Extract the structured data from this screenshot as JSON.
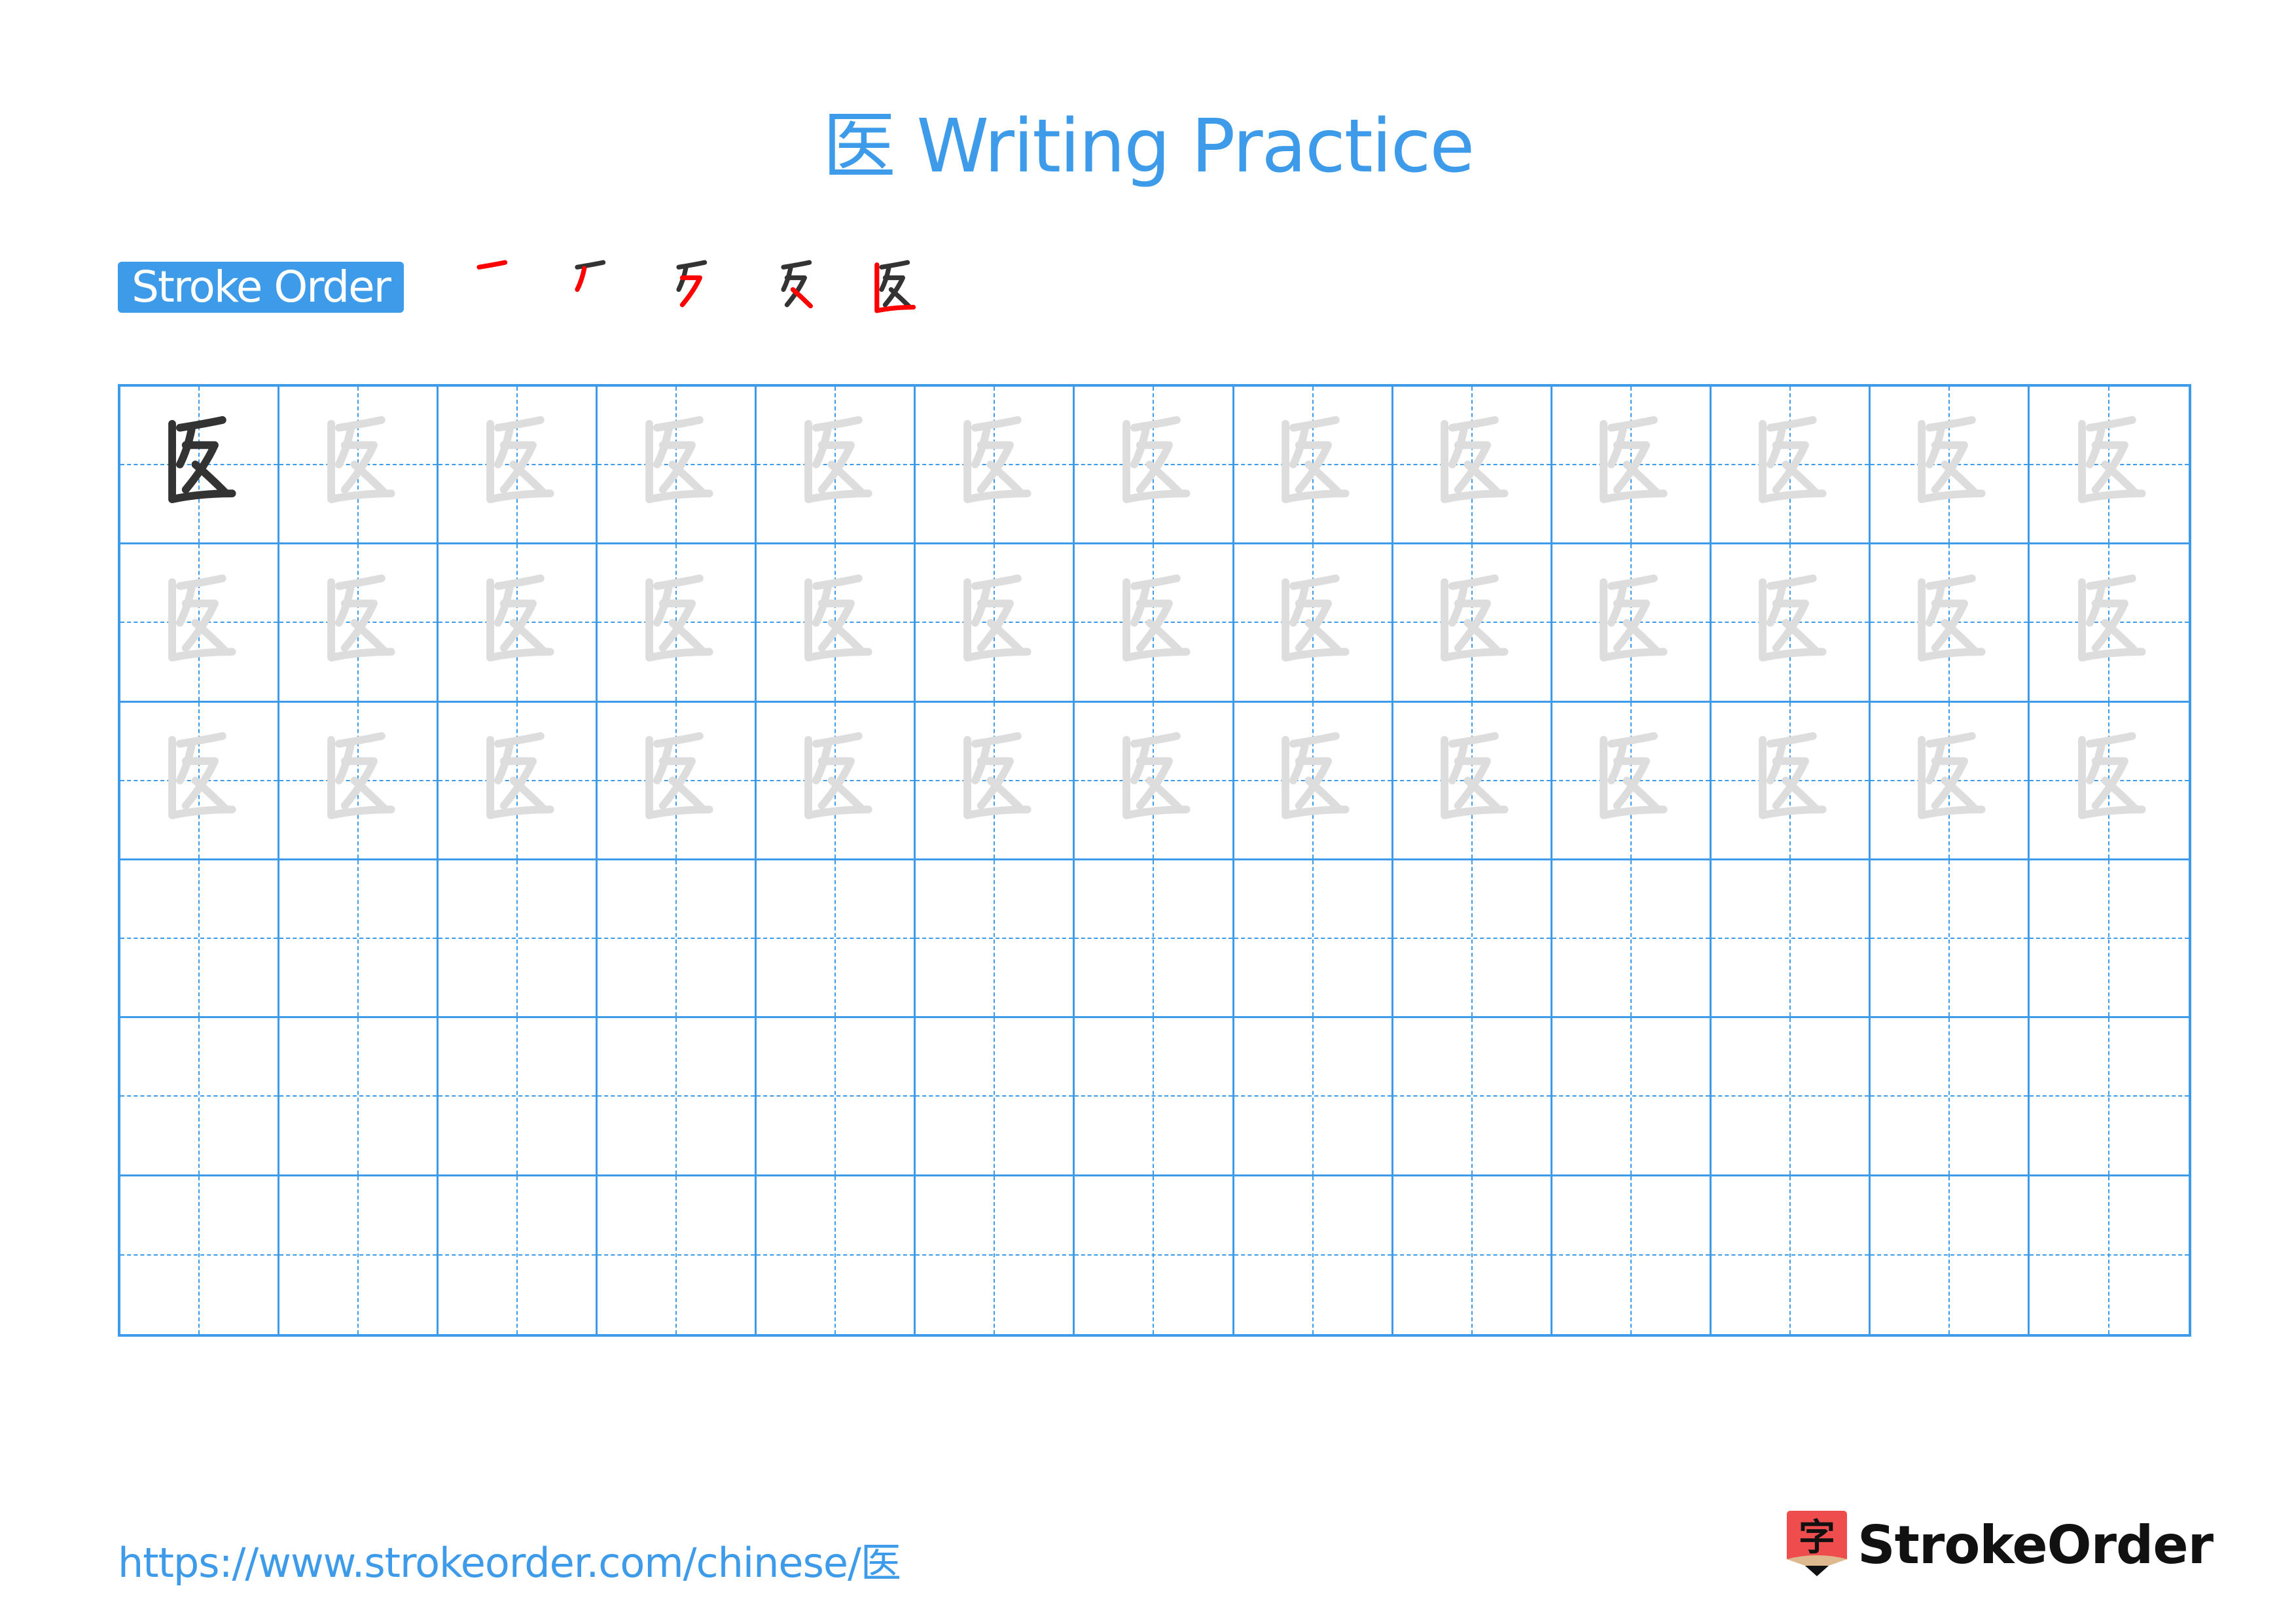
{
  "page": {
    "title": "医 Writing Practice",
    "character": "医"
  },
  "stroke_order": {
    "label": "Stroke Order",
    "total_strokes": 5,
    "steps": [
      {
        "step": 1,
        "highlight_color": "#f00"
      },
      {
        "step": 2,
        "highlight_color": "#f00"
      },
      {
        "step": 3,
        "highlight_color": "#f00"
      },
      {
        "step": 4,
        "highlight_color": "#f00"
      },
      {
        "step": 5,
        "highlight_color": "#f00"
      }
    ]
  },
  "practice_grid": {
    "columns": 13,
    "rows": 6,
    "model_cells": 1,
    "trace_rows": 3,
    "empty_rows": 3,
    "model_color": "#333333",
    "trace_color": "#dddddd",
    "line_color": "#3d9be9"
  },
  "footer": {
    "url": "https://www.strokeorder.com/chinese/医",
    "brand": "StrokeOrder",
    "brand_icon_char": "字"
  },
  "colors": {
    "accent": "#3d9be9",
    "stroke_highlight": "#ff0000",
    "logo_red": "#ef4d4d"
  }
}
